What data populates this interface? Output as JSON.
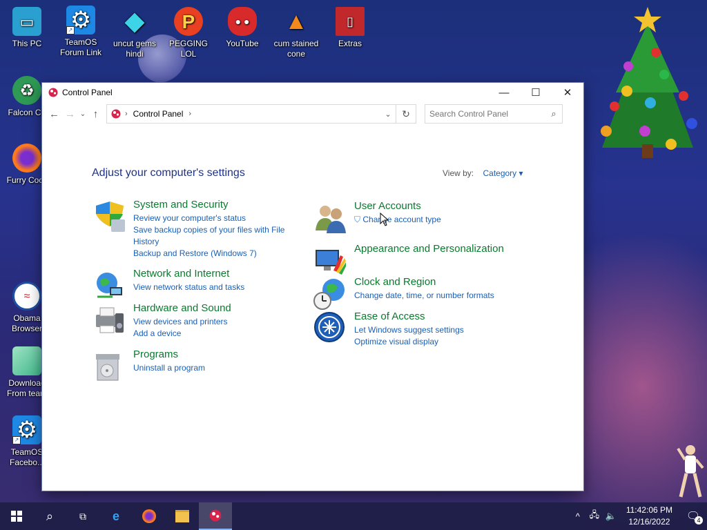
{
  "desktop": {
    "icons": [
      {
        "label": "This PC"
      },
      {
        "label": "TeamOS Forum Link"
      },
      {
        "label": "uncut gems hindi"
      },
      {
        "label": "PEGGING LOL"
      },
      {
        "label": "YouTube"
      },
      {
        "label": "cum stained cone"
      },
      {
        "label": "Extras"
      },
      {
        "label": "Falcon C+"
      },
      {
        "label": "Furry Cock"
      },
      {
        "label": "Obama Browser"
      },
      {
        "label": "Download From team"
      },
      {
        "label": "TeamOS Facebo..."
      }
    ]
  },
  "window": {
    "title": "Control Panel",
    "address": {
      "crumb": "Control Panel"
    },
    "search": {
      "placeholder": "Search Control Panel"
    },
    "heading": "Adjust your computer's settings",
    "view_by": {
      "label": "View by:",
      "value": "Category"
    },
    "left_categories": [
      {
        "title": "System and Security",
        "links": [
          "Review your computer's status",
          "Save backup copies of your files with File History",
          "Backup and Restore (Windows 7)"
        ]
      },
      {
        "title": "Network and Internet",
        "links": [
          "View network status and tasks"
        ]
      },
      {
        "title": "Hardware and Sound",
        "links": [
          "View devices and printers",
          "Add a device"
        ]
      },
      {
        "title": "Programs",
        "links": [
          "Uninstall a program"
        ]
      }
    ],
    "right_categories": [
      {
        "title": "User Accounts",
        "links": [
          "Change account type"
        ]
      },
      {
        "title": "Appearance and Personalization",
        "links": []
      },
      {
        "title": "Clock and Region",
        "links": [
          "Change date, time, or number formats"
        ]
      },
      {
        "title": "Ease of Access",
        "links": [
          "Let Windows suggest settings",
          "Optimize visual display"
        ]
      }
    ]
  },
  "taskbar": {
    "time": "11:42:06 PM",
    "date": "12/16/2022",
    "notification_count": "4"
  }
}
